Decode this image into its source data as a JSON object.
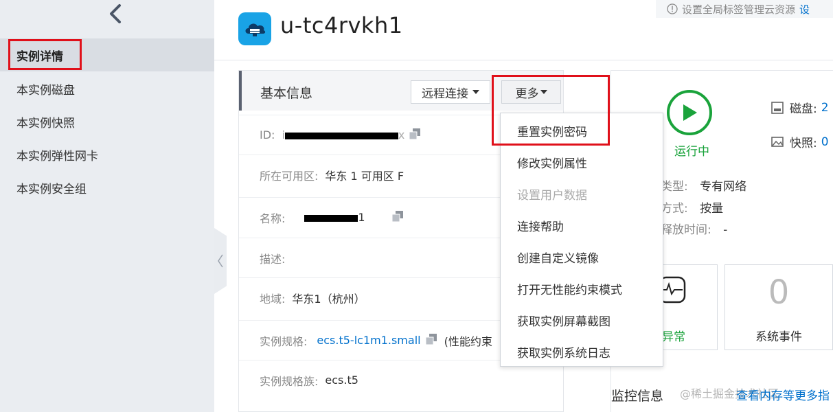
{
  "sidebar": {
    "back_icon": "chevron-left-icon",
    "items": [
      {
        "label": "实例详情",
        "active": true
      },
      {
        "label": "本实例磁盘",
        "active": false
      },
      {
        "label": "本实例快照",
        "active": false
      },
      {
        "label": "本实例弹性网卡",
        "active": false
      },
      {
        "label": "本实例安全组",
        "active": false
      }
    ]
  },
  "header": {
    "instance_name": "u-tc4rvkh1",
    "notice_text": "设置全局标签管理云资源",
    "notice_link": "设"
  },
  "basic_info": {
    "title": "基本信息",
    "remote_button": "远程连接",
    "more_button": "更多",
    "rows": {
      "id_label": "ID:",
      "id_value_prefix": "i",
      "id_value_suffix": "x",
      "zone_label": "所在可用区:",
      "zone_value": "华东 1 可用区 F",
      "name_label": "名称:",
      "name_value_suffix": "1",
      "desc_label": "描述:",
      "region_label": "地域:",
      "region_value": "华东1（杭州）",
      "spec_label": "实例规格:",
      "spec_value": "ecs.t5-lc1m1.small",
      "spec_extra": "(性能约束",
      "family_label": "实例规格族:",
      "family_value": "ecs.t5"
    }
  },
  "dropdown": {
    "items": [
      {
        "label": "重置实例密码",
        "disabled": false
      },
      {
        "label": "修改实例属性",
        "disabled": false
      },
      {
        "label": "设置用户数据",
        "disabled": true
      },
      {
        "label": "连接帮助",
        "disabled": false
      },
      {
        "label": "创建自定义镜像",
        "disabled": false
      },
      {
        "label": "打开无性能约束模式",
        "disabled": false
      },
      {
        "label": "获取实例屏幕截图",
        "disabled": false
      },
      {
        "label": "获取实例系统日志",
        "disabled": false
      }
    ]
  },
  "status": {
    "run_state": "运行中",
    "disk_label": "磁盘:",
    "disk_count": "2",
    "snapshot_label": "快照:",
    "snapshot_count": "0",
    "network_type_label": "类型:",
    "network_type_value": "专有网络",
    "billing_label": "方式:",
    "billing_value": "按量",
    "release_label": "释放时间:",
    "release_value": "-"
  },
  "events": {
    "alert_label": "异常",
    "system_events_count": "0",
    "system_events_label": "系统事件"
  },
  "monitor": {
    "title": "监控信息",
    "link": "查看内存等更多指",
    "watermark": "@稀土掘金技术社区"
  },
  "colors": {
    "accent_blue": "#0070cc",
    "running_green": "#1aa33b",
    "highlight_red": "#e0101a",
    "instance_icon_blue": "#19a3e6"
  }
}
